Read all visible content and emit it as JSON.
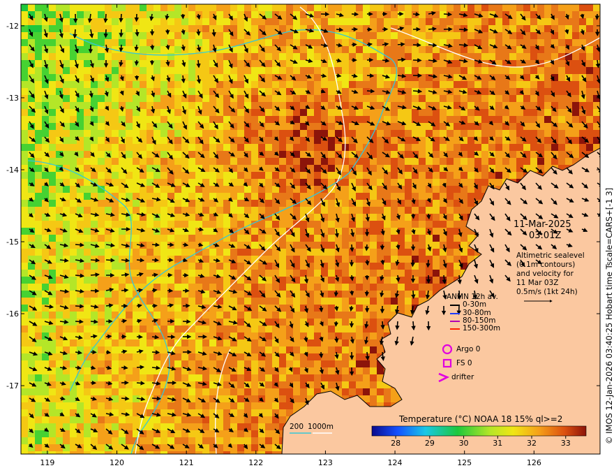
{
  "map": {
    "lat_ticks": [
      "-12",
      "-13",
      "-14",
      "-15",
      "-16",
      "-17"
    ],
    "lon_ticks": [
      "119",
      "120",
      "121",
      "122",
      "123",
      "124",
      "125",
      "126"
    ],
    "lat_range": [
      -17.95,
      -11.7
    ],
    "lon_range": [
      118.62,
      126.95
    ]
  },
  "timestamp": {
    "date": "11-Mar-2025",
    "time": "03:01Z"
  },
  "altimetry": {
    "lines": [
      "Altimetric sealevel",
      "(0.1m contours)",
      "and velocity for",
      "11 Mar 03Z",
      "0.5m/s (1kt 24h)"
    ]
  },
  "anmn_legend": {
    "title": "ANMN 12h av.",
    "items": [
      {
        "label": "0-30m",
        "color": "#000000"
      },
      {
        "label": "30-80m",
        "color": "#1e3cff"
      },
      {
        "label": "80-150m",
        "color": "#b400b4"
      },
      {
        "label": "150-300m",
        "color": "#ff2000"
      }
    ]
  },
  "markers": [
    {
      "label": "Argo 0",
      "icon": "circle-icon",
      "color": "#e000e0"
    },
    {
      "label": "FS 0",
      "icon": "square-icon",
      "color": "#e000e0"
    },
    {
      "label": "drifter",
      "icon": "chevron-icon",
      "color": "#e000e0"
    }
  ],
  "depth_contours": {
    "labels": [
      "200",
      "1000m"
    ],
    "colors": [
      "#35c8d8",
      "#ffffff"
    ]
  },
  "colorbar": {
    "title": "Temperature (°C) NOAA 18 15% ql>=2",
    "ticks": [
      "28",
      "29",
      "30",
      "31",
      "32",
      "33"
    ],
    "range": [
      27.3,
      33.6
    ]
  },
  "side_caption": "© IMOS 12-Jan-2026 03:40:25 Hobart time Tscale=CARS+[-1 3]",
  "colors": {
    "land": "#fbc8a0",
    "coast": "#000000"
  }
}
